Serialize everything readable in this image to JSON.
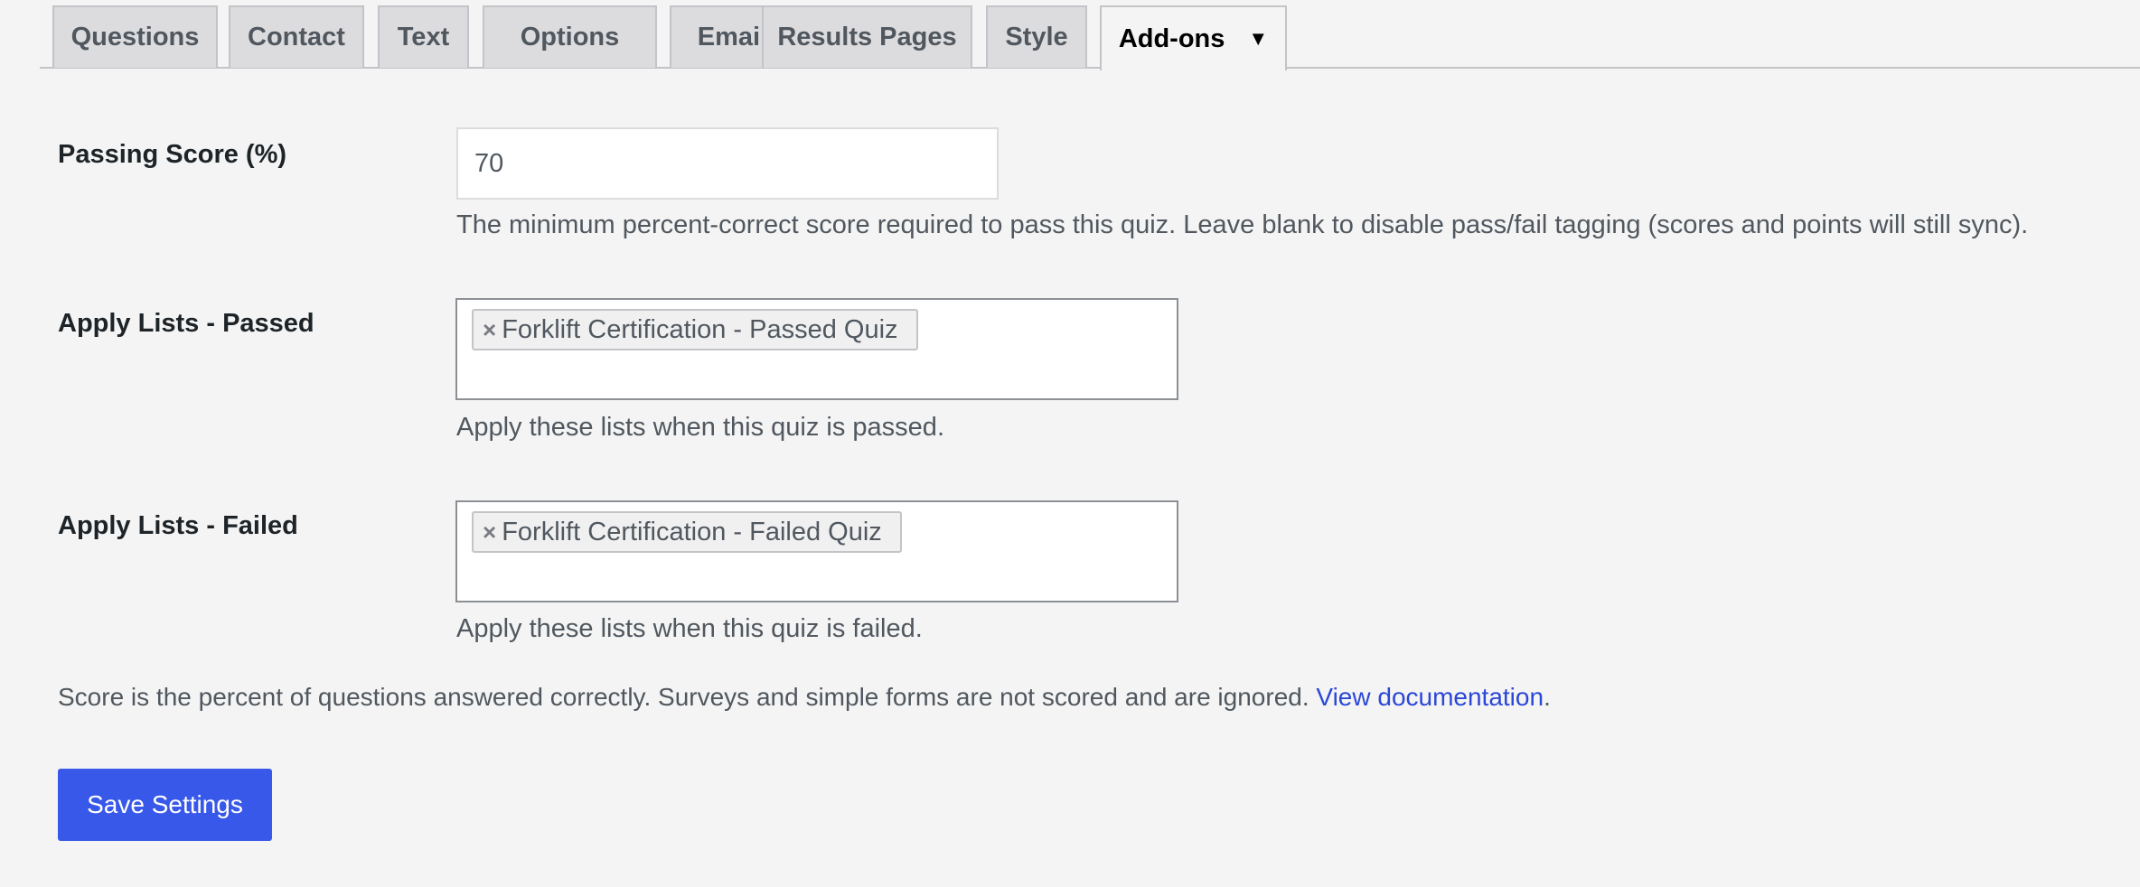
{
  "tabs": [
    {
      "label": "Questions"
    },
    {
      "label": "Contact"
    },
    {
      "label": "Text"
    },
    {
      "label": "Options"
    },
    {
      "label": "Emails"
    },
    {
      "label": "Results Pages"
    },
    {
      "label": "Style"
    },
    {
      "label": "Add-ons",
      "caret": "▼"
    }
  ],
  "passing_score": {
    "label": "Passing Score (%)",
    "value": "70",
    "description": "The minimum percent-correct score required to pass this quiz. Leave blank to disable pass/fail tagging (scores and points will still sync)."
  },
  "apply_passed": {
    "label": "Apply Lists - Passed",
    "chip_remove": "×",
    "chip": "Forklift Certification - Passed Quiz",
    "description": "Apply these lists when this quiz is passed."
  },
  "apply_failed": {
    "label": "Apply Lists - Failed",
    "chip_remove": "×",
    "chip": "Forklift Certification - Failed Quiz",
    "description": "Apply these lists when this quiz is failed."
  },
  "note": {
    "text": "Score is the percent of questions answered correctly. Surveys and simple forms are not scored and are ignored. ",
    "link": "View documentation",
    "trailing": "."
  },
  "save_button": "Save Settings",
  "colors": {
    "accent": "#3858e9",
    "link": "#2b47d8",
    "background": "#f4f4f4"
  }
}
